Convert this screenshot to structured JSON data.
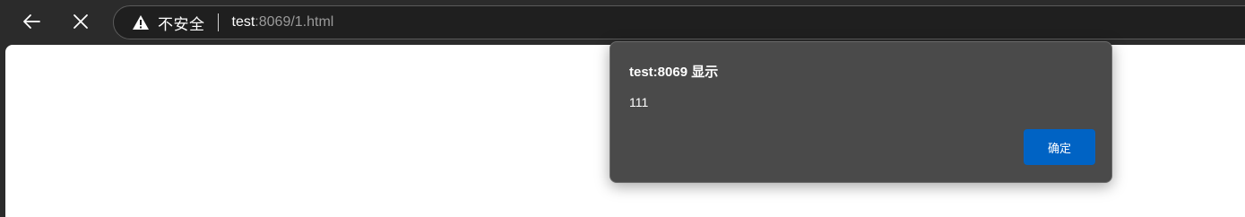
{
  "browser": {
    "back_icon": "arrow-left-icon",
    "close_icon": "close-icon",
    "security_icon": "warning-triangle-icon",
    "security_label": "不安全",
    "url_host": "test",
    "url_rest": ":8069/1.html"
  },
  "dialog": {
    "title": "test:8069 显示",
    "message": "111",
    "ok_label": "确定",
    "ok_color": "#0063c4"
  }
}
